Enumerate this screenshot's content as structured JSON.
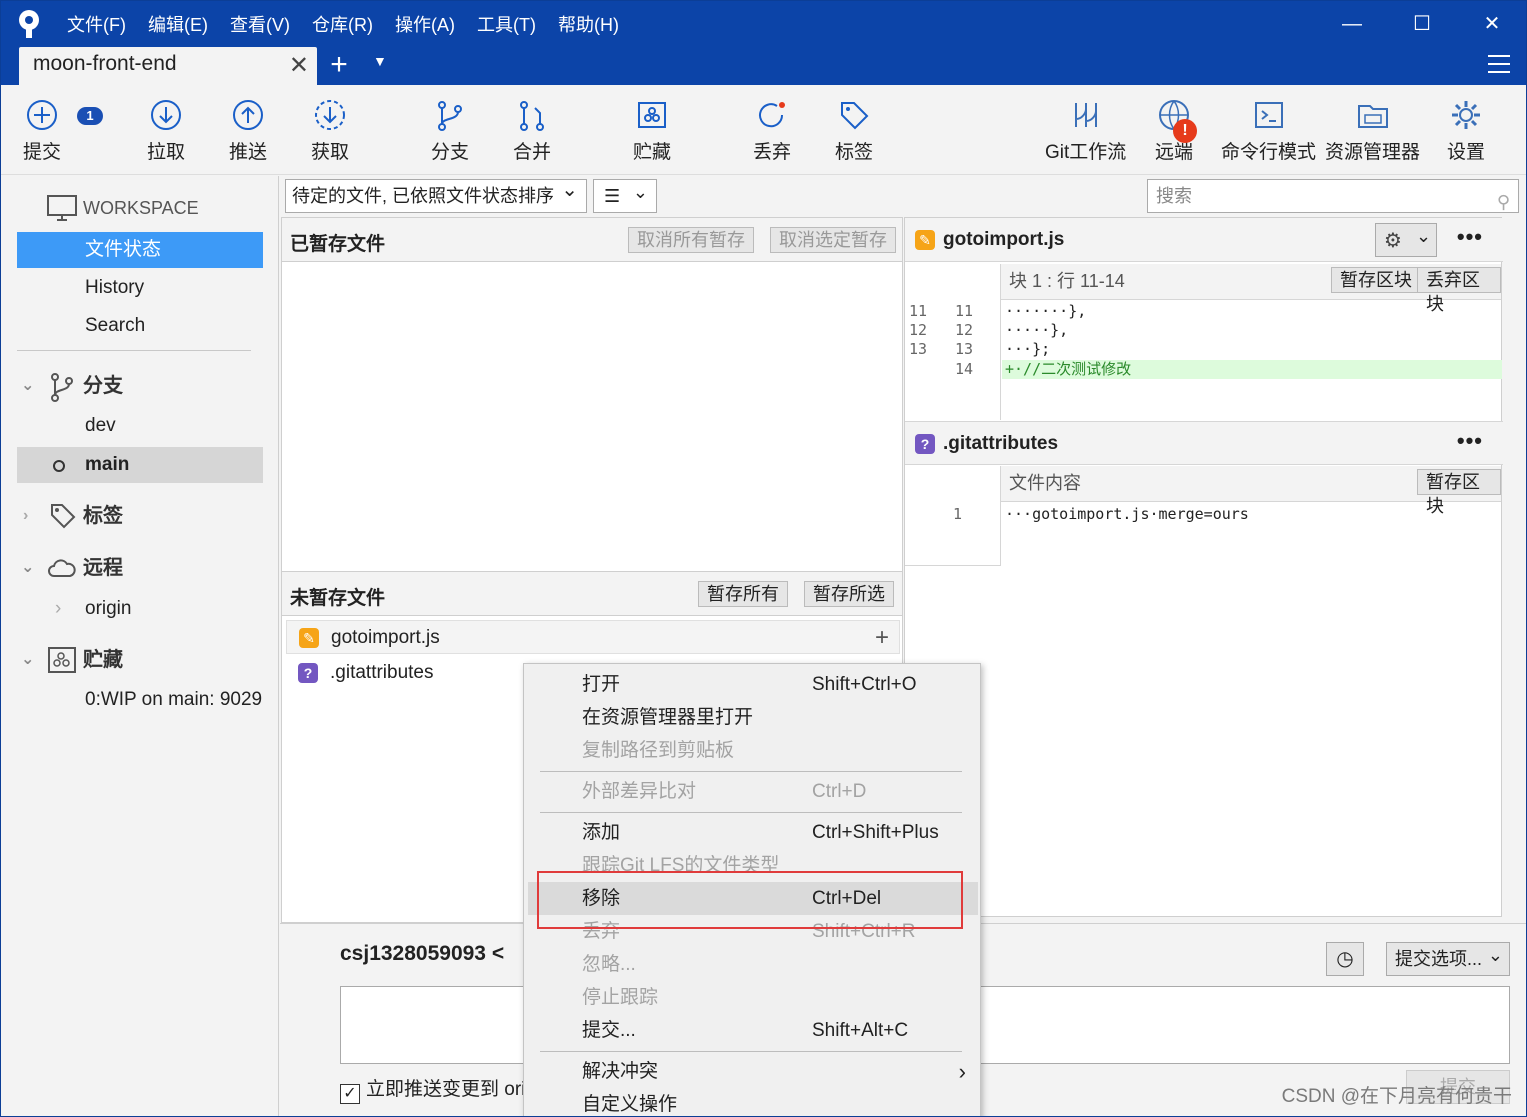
{
  "app": {
    "menu": [
      "文件(F)",
      "编辑(E)",
      "查看(V)",
      "仓库(R)",
      "操作(A)",
      "工具(T)",
      "帮助(H)"
    ],
    "tab_name": "moon-front-end"
  },
  "toolbar": {
    "commit": "提交",
    "commit_badge": "1",
    "pull": "拉取",
    "push": "推送",
    "fetch": "获取",
    "branch": "分支",
    "merge": "合并",
    "stash": "贮藏",
    "discard": "丢弃",
    "tag": "标签",
    "gitflow": "Git工作流",
    "remote": "远端",
    "remote_alert": "!",
    "terminal": "命令行模式",
    "explorer": "资源管理器",
    "settings": "设置"
  },
  "sidebar": {
    "workspace": "WORKSPACE",
    "file_status": "文件状态",
    "history": "History",
    "search": "Search",
    "branches": "分支",
    "branch_items": [
      "dev",
      "main"
    ],
    "tags": "标签",
    "remotes": "远程",
    "remote_items": [
      "origin"
    ],
    "stashes": "贮藏",
    "stash_items": [
      "0:WIP on main: 9029"
    ]
  },
  "filter": {
    "sort": "待定的文件, 已依照文件状态排序",
    "view": "☰",
    "search_placeholder": "搜索"
  },
  "staged": {
    "title": "已暂存文件",
    "unstage_all": "取消所有暂存",
    "unstage_selected": "取消选定暂存"
  },
  "unstaged": {
    "title": "未暂存文件",
    "stage_all": "暂存所有",
    "stage_selected": "暂存所选",
    "files": [
      {
        "name": "gotoimport.js",
        "status": "modified"
      },
      {
        "name": ".gitattributes",
        "status": "untracked"
      }
    ]
  },
  "diff": {
    "file1": {
      "name": "gotoimport.js",
      "hunk": "块 1 :   行 11-14",
      "stage_hunk": "暂存区块",
      "discard_hunk": "丢弃区块",
      "lines": [
        {
          "old": "11",
          "new": "11",
          "text": "·······},"
        },
        {
          "old": "12",
          "new": "12",
          "text": "·····},"
        },
        {
          "old": "13",
          "new": "13",
          "text": "···};"
        },
        {
          "old": "",
          "new": "14",
          "text": "+·//二次测试修改"
        }
      ]
    },
    "file2": {
      "name": ".gitattributes",
      "hunk": "文件内容",
      "stage_hunk": "暂存区块",
      "lines": [
        {
          "old": "",
          "new": "1",
          "text": "···gotoimport.js·merge=ours"
        }
      ]
    }
  },
  "commit": {
    "author": "csj1328059093 <",
    "options": "提交选项...",
    "push_now": "立即推送变更到 ori",
    "submit": "提交"
  },
  "context_menu": [
    {
      "label": "打开",
      "shortcut": "Shift+Ctrl+O",
      "enabled": true
    },
    {
      "label": "在资源管理器里打开",
      "shortcut": "",
      "enabled": true
    },
    {
      "label": "复制路径到剪贴板",
      "shortcut": "",
      "enabled": false
    },
    {
      "label": "外部差异比对",
      "shortcut": "Ctrl+D",
      "enabled": false
    },
    {
      "label": "添加",
      "shortcut": "Ctrl+Shift+Plus",
      "enabled": true
    },
    {
      "label": "跟踪Git LFS的文件类型",
      "shortcut": "",
      "enabled": false
    },
    {
      "label": "移除",
      "shortcut": "Ctrl+Del",
      "enabled": true,
      "highlighted": true
    },
    {
      "label": "丢弃",
      "shortcut": "Shift+Ctrl+R",
      "enabled": false
    },
    {
      "label": "忽略...",
      "shortcut": "",
      "enabled": false
    },
    {
      "label": "停止跟踪",
      "shortcut": "",
      "enabled": false
    },
    {
      "label": "提交...",
      "shortcut": "Shift+Alt+C",
      "enabled": true
    },
    {
      "label": "解决冲突",
      "shortcut": "",
      "enabled": true,
      "submenu": true
    },
    {
      "label": "自定义操作",
      "shortcut": "",
      "enabled": true
    }
  ],
  "watermark": "CSDN @在下月亮有何贵干",
  "colors": {
    "titlebar": "#0c44a8",
    "selection": "#3d9af7",
    "highlight_box": "#e03b3b",
    "added_line": "#ddfbdc"
  }
}
